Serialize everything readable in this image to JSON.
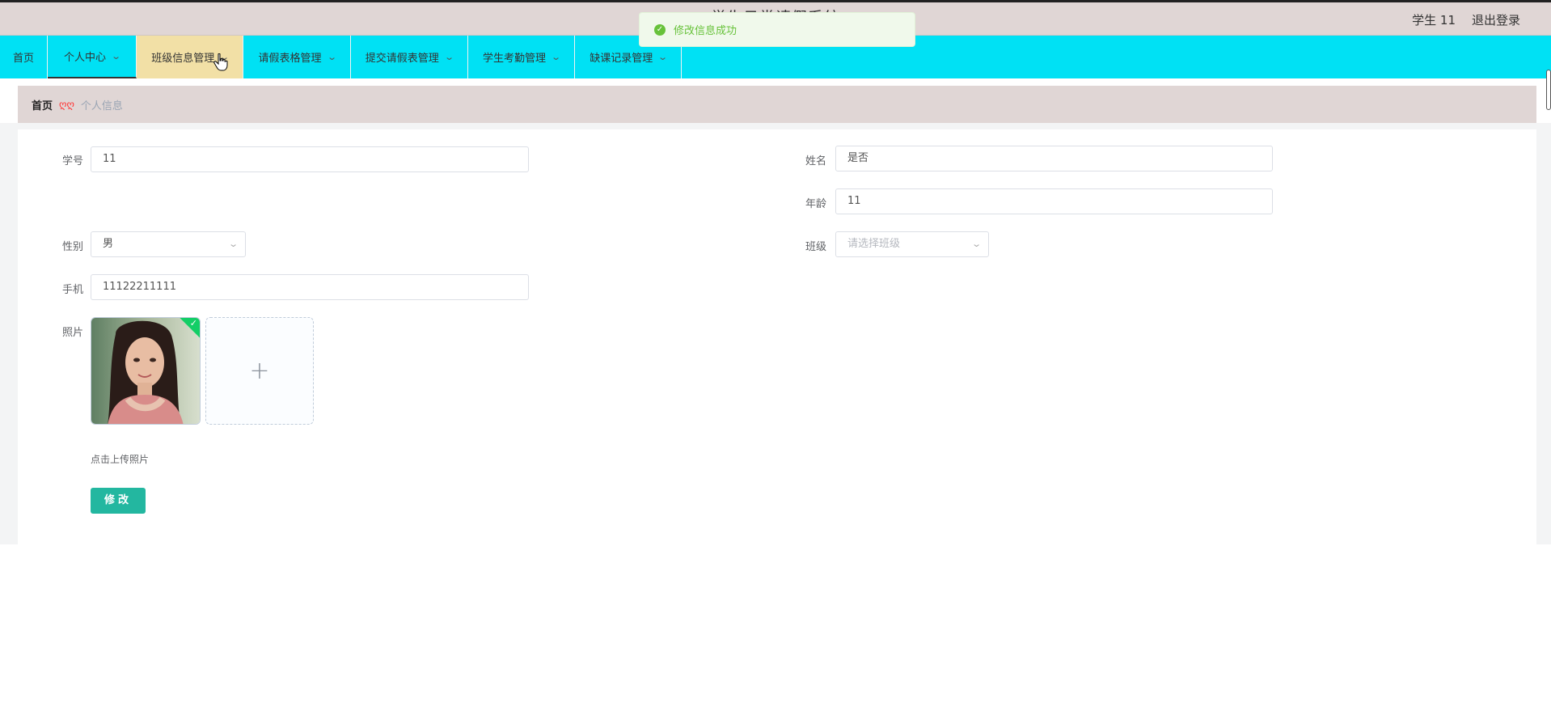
{
  "header": {
    "app_title": "学生日常请假系统",
    "user_name": "学生 11",
    "logout_label": "退出登录"
  },
  "toast": {
    "icon": "success-check-icon",
    "message": "修改信息成功",
    "color": "#67c23a"
  },
  "nav": {
    "items": [
      {
        "label": "首页"
      },
      {
        "label": "个人中心"
      },
      {
        "label": "班级信息管理"
      },
      {
        "label": "请假表格管理"
      },
      {
        "label": "提交请假表管理"
      },
      {
        "label": "学生考勤管理"
      },
      {
        "label": "缺课记录管理"
      }
    ],
    "bg_color": "#00e1f4",
    "hover_color": "#f2e0a6"
  },
  "breadcrumb": {
    "home": "首页",
    "separator": "ღღ",
    "current": "个人信息"
  },
  "form": {
    "student_id_label": "学号",
    "student_id_value": "11",
    "name_label": "姓名",
    "name_value": "是否",
    "age_label": "年龄",
    "age_value": "11",
    "gender_label": "性别",
    "gender_value": "男",
    "class_label": "班级",
    "class_placeholder": "请选择班级",
    "phone_label": "手机",
    "phone_value": "11122211111",
    "photo_label": "照片",
    "upload_tip": "点击上传照片",
    "submit_label": "修改"
  },
  "colors": {
    "header_bg": "#e0d6d5",
    "button_bg": "#23b7a0",
    "photo_success": "#13ce66"
  }
}
